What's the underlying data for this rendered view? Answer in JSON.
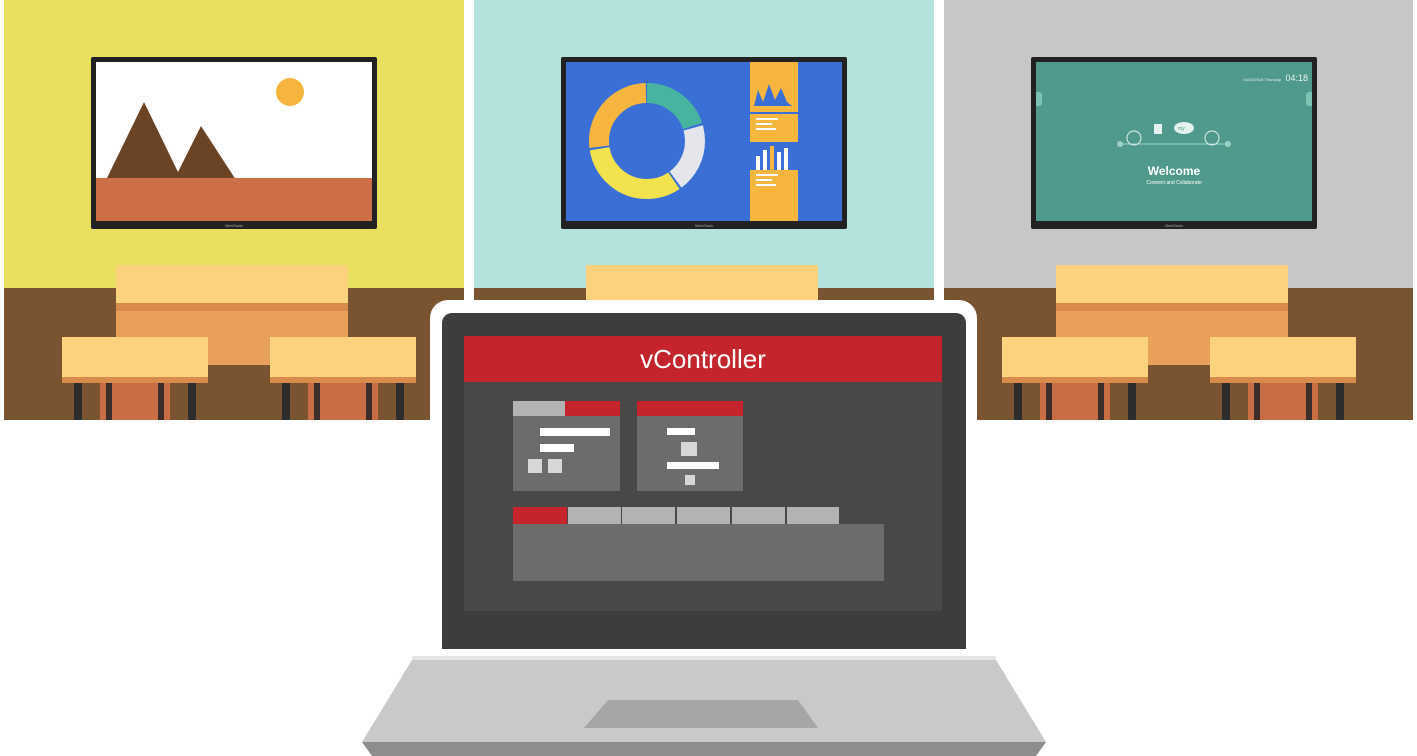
{
  "app": {
    "title": "vController"
  },
  "screens": {
    "welcome": {
      "date": "04/10/2018 Thursday",
      "time": "04:18",
      "title": "Welcome",
      "subtitle": "Connect and Collaborate",
      "cloud_label": "my"
    }
  },
  "colors": {
    "accent": "#c4252c",
    "yellow_wall": "#e8e05e",
    "cyan_wall": "#b3e3dc",
    "gray_wall": "#c7c7c7",
    "floor": "#7a5330",
    "welcome_screen": "#4f9a8c",
    "chart_blue": "#3a6fd6",
    "chart_orange": "#f5b53f",
    "chart_teal": "#47b4a0"
  },
  "icons": [
    "sun-icon",
    "mountain-icon",
    "donut-chart-icon",
    "bar-chart-icon",
    "cloud-icon",
    "document-icon",
    "camera-icon",
    "wifi-icon"
  ]
}
